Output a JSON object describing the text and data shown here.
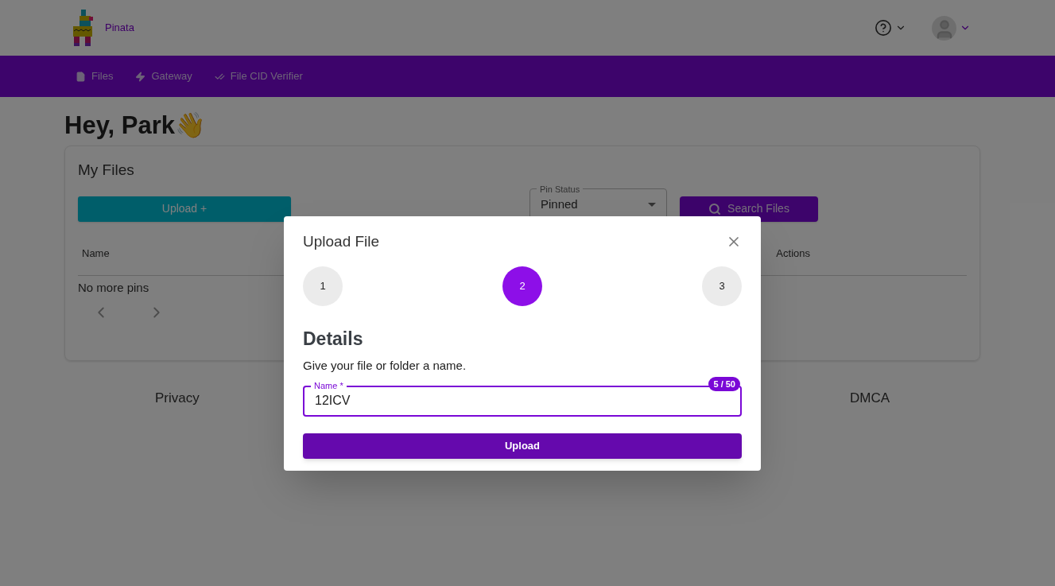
{
  "header": {
    "brand": "Pinata"
  },
  "nav": [
    {
      "label": "Files"
    },
    {
      "label": "Gateway"
    },
    {
      "label": "File CID Verifier"
    }
  ],
  "greeting": "Hey, Park👋",
  "files_card": {
    "title": "My Files",
    "upload_button": "Upload +",
    "pin_status": {
      "label": "Pin Status",
      "value": "Pinned"
    },
    "search_button": "Search Files",
    "columns": [
      "Name",
      "Actions"
    ],
    "empty_text": "No more pins"
  },
  "footer": [
    "Privacy",
    "DMCA"
  ],
  "dialog": {
    "title": "Upload File",
    "steps": [
      {
        "label": "1",
        "selected": false
      },
      {
        "label": "2",
        "selected": true
      },
      {
        "label": "3",
        "selected": false
      }
    ],
    "heading": "Details",
    "description": "Give your file or folder a name.",
    "field": {
      "label": "Name *",
      "value": "12ICV",
      "counter": "5 / 50"
    },
    "submit": "Upload"
  }
}
